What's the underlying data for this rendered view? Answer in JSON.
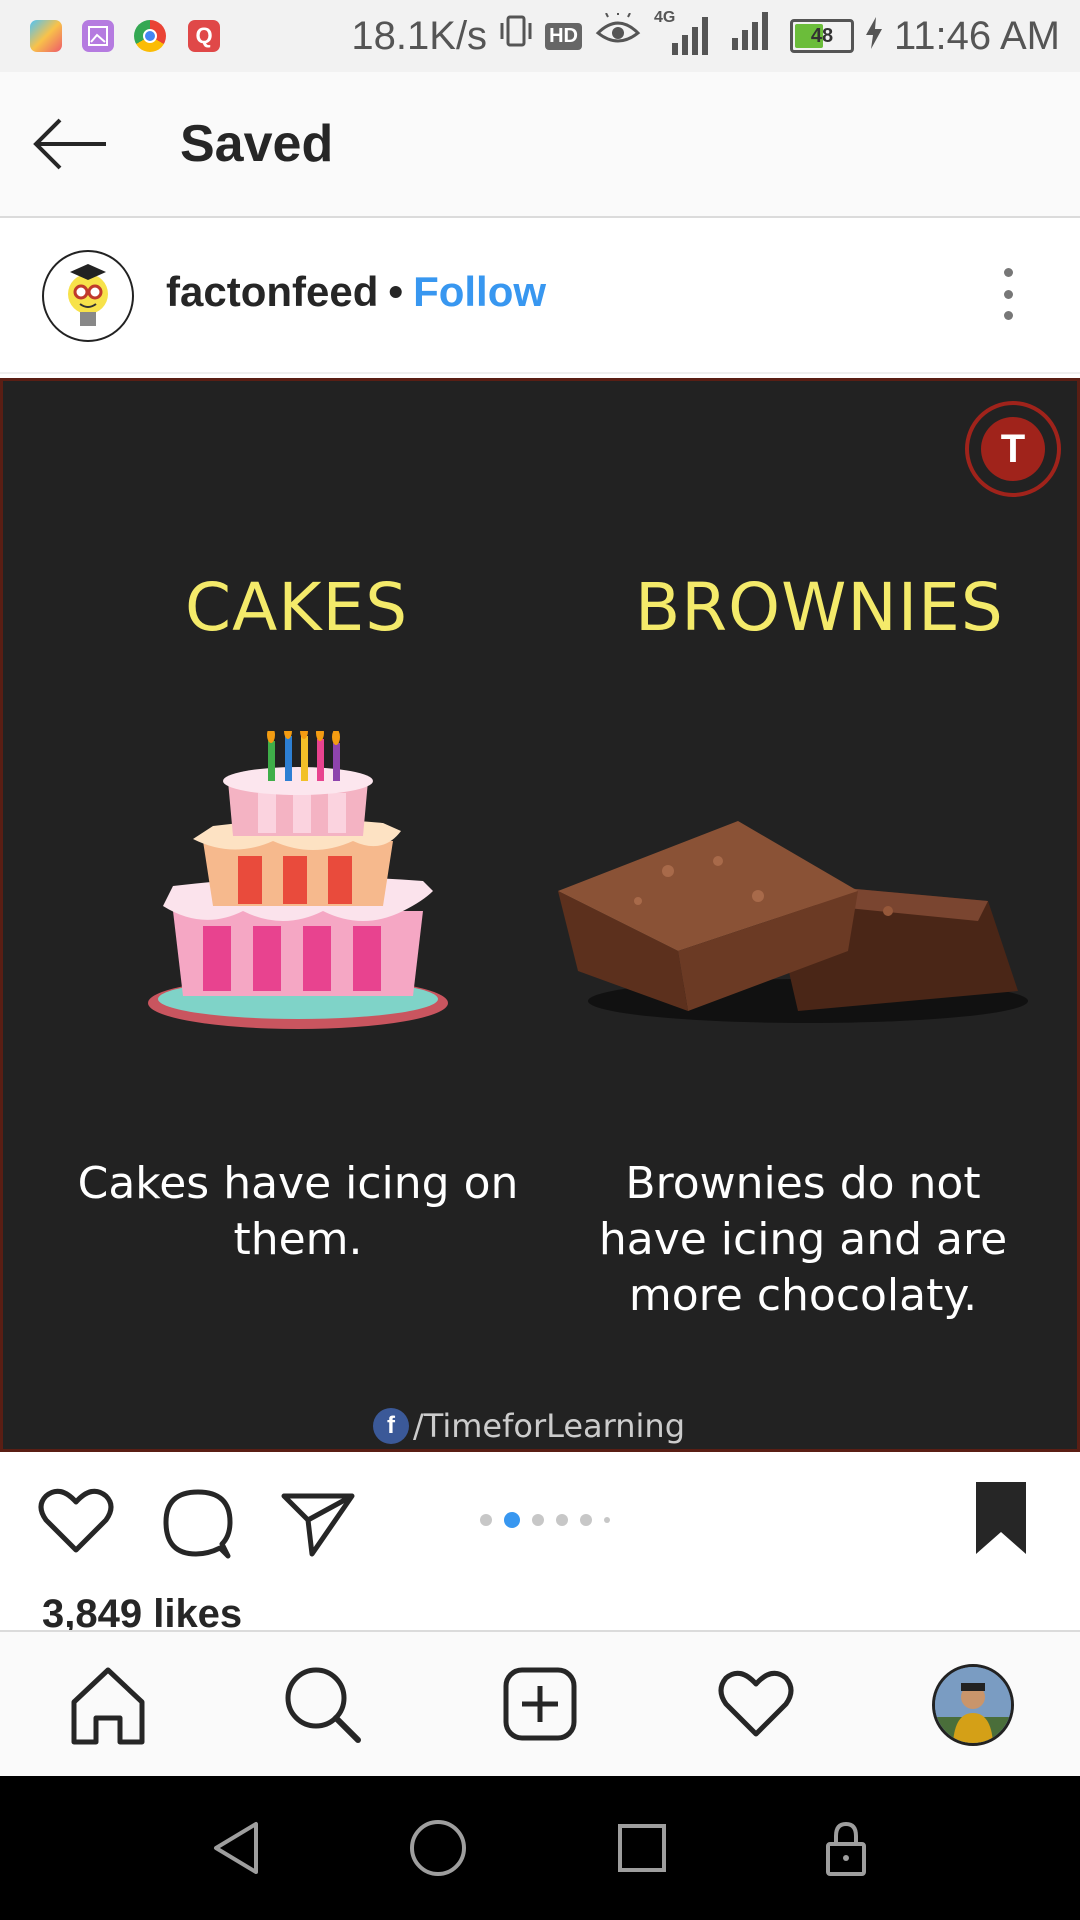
{
  "status_bar": {
    "net_speed": "18.1K/s",
    "hd": "HD",
    "network": "4G",
    "battery": "48",
    "battery_level": 0.48,
    "time": "11:46 AM",
    "app_icons": [
      "puzzle-app-icon",
      "gallery-app-icon",
      "chrome-icon",
      "q-app-icon"
    ]
  },
  "header": {
    "back_icon": "back-arrow-icon",
    "title": "Saved"
  },
  "post": {
    "username": "factonfeed",
    "separator": "•",
    "follow_label": "Follow",
    "options_icon": "more-vertical-icon",
    "image": {
      "left_heading": "CAKES",
      "right_heading": "BROWNIES",
      "left_caption_line1": "Cakes have icing on",
      "left_caption_line2": "them.",
      "right_caption_line1": "Brownies do not",
      "right_caption_line2": "have icing and are",
      "right_caption_line3": "more chocolaty.",
      "credit_icon": "f",
      "credit_text": "/TimeforLearning",
      "logo_letter": "T"
    },
    "actions": [
      "heart-icon",
      "comment-icon",
      "share-icon",
      "bookmark-icon"
    ],
    "carousel": {
      "total": 6,
      "active_index": 1
    },
    "likes": "3,849 likes"
  },
  "bottom_nav": [
    "home-icon",
    "search-icon",
    "add-post-icon",
    "activity-heart-icon",
    "profile-avatar"
  ],
  "colors": {
    "accent": "#3897f0",
    "heading_yellow": "#f4ea6a",
    "image_bg": "#222222"
  }
}
